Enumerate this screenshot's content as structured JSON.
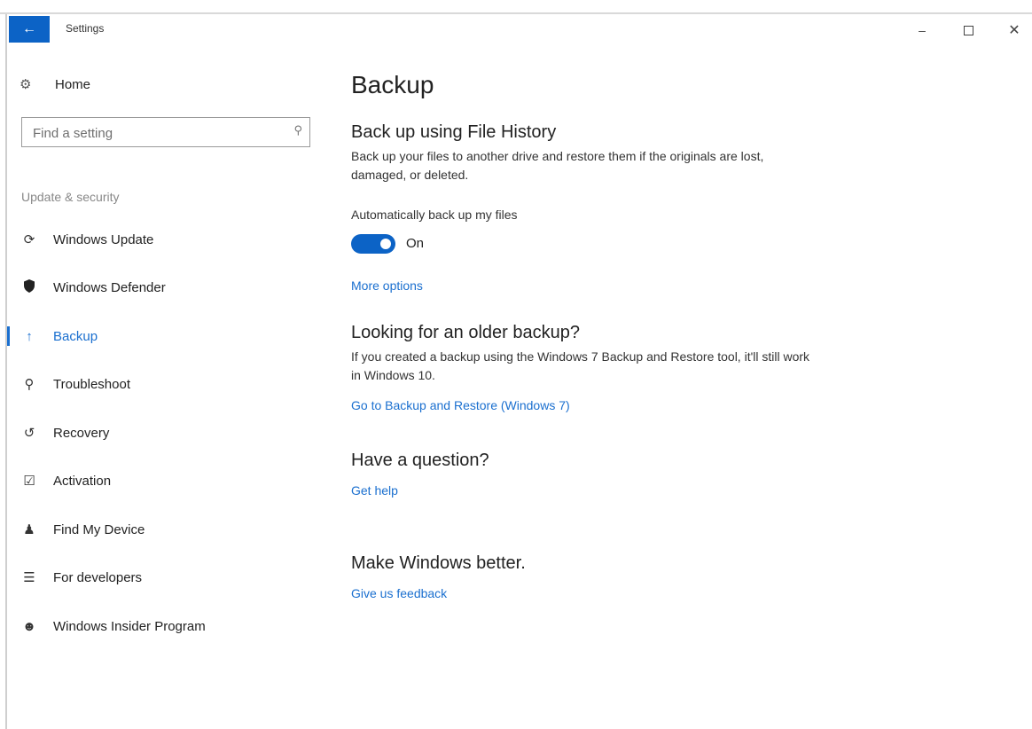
{
  "window": {
    "title": "Settings",
    "back_icon": "arrow-left-icon",
    "minimize_label": "–",
    "close_label": "✕"
  },
  "sidebar": {
    "home_label": "Home",
    "search_placeholder": "Find a setting",
    "section_label": "Update & security",
    "items": [
      {
        "label": "Windows Update",
        "icon": "refresh-icon"
      },
      {
        "label": "Windows Defender",
        "icon": "shield-icon"
      },
      {
        "label": "Backup",
        "icon": "up-arrow-icon",
        "active": true
      },
      {
        "label": "Troubleshoot",
        "icon": "wrench-icon"
      },
      {
        "label": "Recovery",
        "icon": "history-icon"
      },
      {
        "label": "Activation",
        "icon": "check-circle-icon"
      },
      {
        "label": "Find My Device",
        "icon": "person-pin-icon"
      },
      {
        "label": "For developers",
        "icon": "developer-icon"
      },
      {
        "label": "Windows Insider Program",
        "icon": "insider-icon"
      }
    ]
  },
  "main": {
    "title": "Backup",
    "file_history": {
      "heading": "Back up using File History",
      "description": "Back up your files to another drive and restore them if the originals are lost, damaged, or deleted.",
      "auto_label": "Automatically back up my files",
      "toggle_state": "On",
      "more_options": "More options"
    },
    "older_backup": {
      "heading": "Looking for an older backup?",
      "description": "If you created a backup using the Windows 7 Backup and Restore tool, it'll still work in Windows 10.",
      "link": "Go to Backup and Restore (Windows 7)"
    },
    "question": {
      "heading": "Have a question?",
      "link": "Get help"
    },
    "feedback": {
      "heading": "Make Windows better.",
      "link": "Give us feedback"
    }
  },
  "colors": {
    "accent": "#0c63c6",
    "link": "#1a6fcf"
  }
}
